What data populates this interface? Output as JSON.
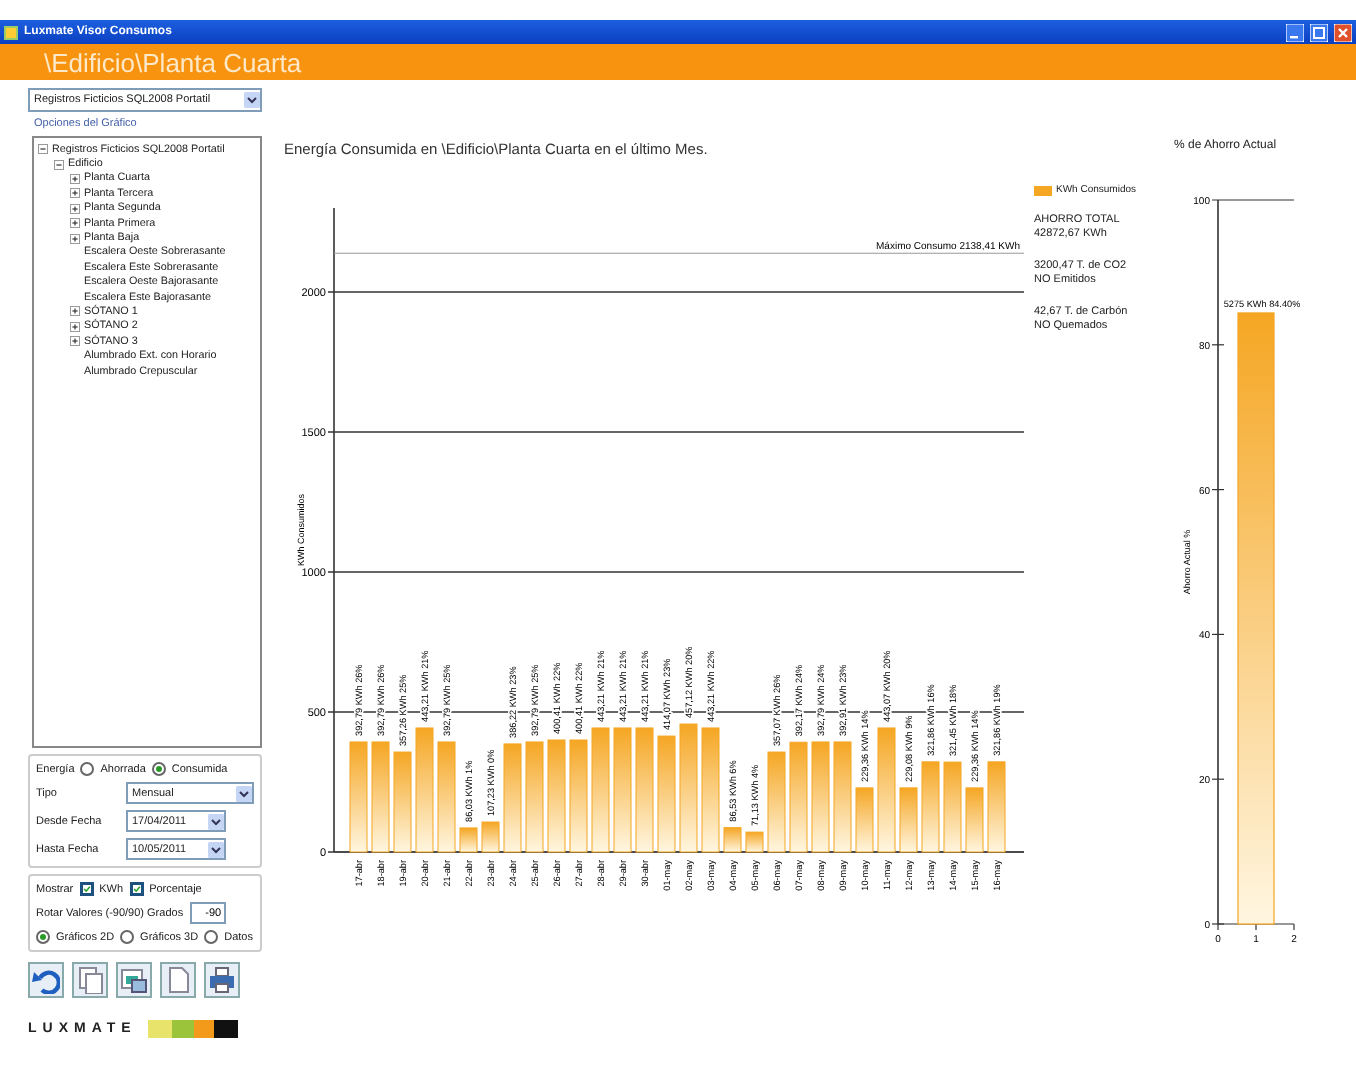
{
  "window": {
    "title": "Luxmate Visor Consumos"
  },
  "header": {
    "path": "\\Edificio\\Planta Cuarta"
  },
  "sidebar": {
    "source": "Registros Ficticios SQL2008 Portatil",
    "options_label": "Opciones del Gráfico",
    "tree": [
      {
        "label": "Registros Ficticios SQL2008 Portatil",
        "expanded": true,
        "children": [
          {
            "label": "Edificio",
            "expanded": true,
            "children": [
              {
                "label": "Planta Cuarta",
                "expanded": false
              },
              {
                "label": "Planta Tercera",
                "expanded": false
              },
              {
                "label": "Planta Segunda",
                "expanded": false
              },
              {
                "label": "Planta Primera",
                "expanded": false
              },
              {
                "label": "Planta Baja",
                "expanded": false
              },
              {
                "label": "Escalera Oeste Sobrerasante"
              },
              {
                "label": "Escalera Este Sobrerasante"
              },
              {
                "label": "Escalera Oeste Bajorasante"
              },
              {
                "label": "Escalera Este Bajorasante"
              },
              {
                "label": "SÓTANO 1",
                "expanded": false
              },
              {
                "label": "SÓTANO 2",
                "expanded": false
              },
              {
                "label": "SÓTANO 3",
                "expanded": false
              },
              {
                "label": "Alumbrado Ext. con Horario"
              },
              {
                "label": "Alumbrado Crepuscular"
              }
            ]
          }
        ]
      }
    ],
    "energy": {
      "label": "Energía",
      "options": [
        {
          "label": "Ahorrada",
          "selected": false
        },
        {
          "label": "Consumida",
          "selected": true
        }
      ]
    },
    "fields": [
      {
        "label": "Tipo",
        "value": "Mensual",
        "kind": "dropdown"
      },
      {
        "label": "Desde Fecha",
        "value": "17/04/2011",
        "kind": "date"
      },
      {
        "label": "Hasta Fecha",
        "value": "10/05/2011",
        "kind": "date"
      }
    ],
    "show": {
      "label": "Mostrar",
      "options": [
        {
          "label": "KWh",
          "checked": true
        },
        {
          "label": "Porcentaje",
          "checked": true
        }
      ]
    },
    "rotate": {
      "label": "Rotar Valores (-90/90) Grados",
      "value": "-90"
    },
    "views": [
      {
        "label": "Gráficos 2D",
        "selected": true
      },
      {
        "label": "Gráficos 3D",
        "selected": false
      },
      {
        "label": "Datos",
        "selected": false
      }
    ],
    "toolbar": [
      {
        "kind": "undo"
      },
      {
        "kind": "copy"
      },
      {
        "kind": "image"
      },
      {
        "kind": "page"
      },
      {
        "kind": "print"
      }
    ],
    "logo": "LUXMATE"
  },
  "main": {
    "stats": [
      "AHORRO TOTAL\n42872,67 KWh",
      "3200,47 T. de CO2\nNO Emitidos",
      "42,67 T. de Carbón\nNO Quemados"
    ],
    "chart_data": {
      "type": "bar",
      "title": "Energía Consumida en \\Edificio\\Planta Cuarta en el último Mes.",
      "ylabel": "KWh Consumidos",
      "categories": [
        "17-abr",
        "18-abr",
        "19-abr",
        "20-abr",
        "21-abr",
        "22-abr",
        "23-abr",
        "24-abr",
        "25-abr",
        "26-abr",
        "27-abr",
        "28-abr",
        "29-abr",
        "30-abr",
        "01-may",
        "02-may",
        "03-may",
        "04-may",
        "05-may",
        "06-may",
        "07-may",
        "08-may",
        "09-may",
        "10-may",
        "11-may",
        "12-may",
        "13-may",
        "14-may",
        "15-may",
        "16-may"
      ],
      "series": [
        {
          "name": "KWh Consumidos",
          "color": "#f5a623",
          "values": [
            393,
            393,
            357,
            443,
            393,
            86,
            107,
            386,
            393,
            400,
            400,
            443,
            443,
            443,
            414,
            457,
            443,
            87,
            71,
            357,
            392,
            393,
            393,
            229,
            443,
            229,
            322,
            321,
            229,
            322
          ]
        }
      ],
      "ylim": [
        0,
        2300
      ],
      "yticks": [
        0,
        500,
        1000,
        1500,
        2000
      ],
      "grid": true,
      "value_labels": [
        "392,79 KWh 26%",
        "392,79 KWh 26%",
        "357,26 KWh 25%",
        "443,21 KWh 21%",
        "392,79 KWh 25%",
        "86,03 KWh 1%",
        "107,23 KWh 0%",
        "386,22 KWh 23%",
        "392,79 KWh 25%",
        "400,41 KWh 22%",
        "400,41 KWh 22%",
        "443,21 KWh 21%",
        "443,21 KWh 21%",
        "443,21 KWh 21%",
        "414,07 KWh 23%",
        "457,12 KWh 20%",
        "443,21 KWh 22%",
        "86,53 KWh 6%",
        "71,13 KWh 4%",
        "357,07 KWh 26%",
        "392,17 KWh 24%",
        "392,79 KWh 24%",
        "392,91 KWh 23%",
        "229,36 KWh 14%",
        "443,07 KWh 20%",
        "229,08 KWh 9%",
        "321,86 KWh 16%",
        "321,45 KWh 18%",
        "229,36 KWh 14%",
        "321,86 KWh 19%"
      ],
      "ref_lines": [
        {
          "axis": "y",
          "value": 2138.41,
          "label": "Máximo Consumo 2138,41 KWh"
        }
      ]
    }
  },
  "side": {
    "chart_data": {
      "type": "bar",
      "title": "% de Ahorro Actual",
      "ylabel": "Ahorro Actual %",
      "x": [
        1
      ],
      "series": [
        {
          "color": "#f5a623",
          "values": [
            84.4
          ]
        }
      ],
      "xlim": [
        0,
        2
      ],
      "xticks": [
        0,
        1,
        2
      ],
      "ylim": [
        0,
        100
      ],
      "yticks": [
        0,
        20,
        40,
        60,
        80,
        100
      ],
      "value_labels": [
        "5275 KWh 84.40%"
      ]
    }
  }
}
